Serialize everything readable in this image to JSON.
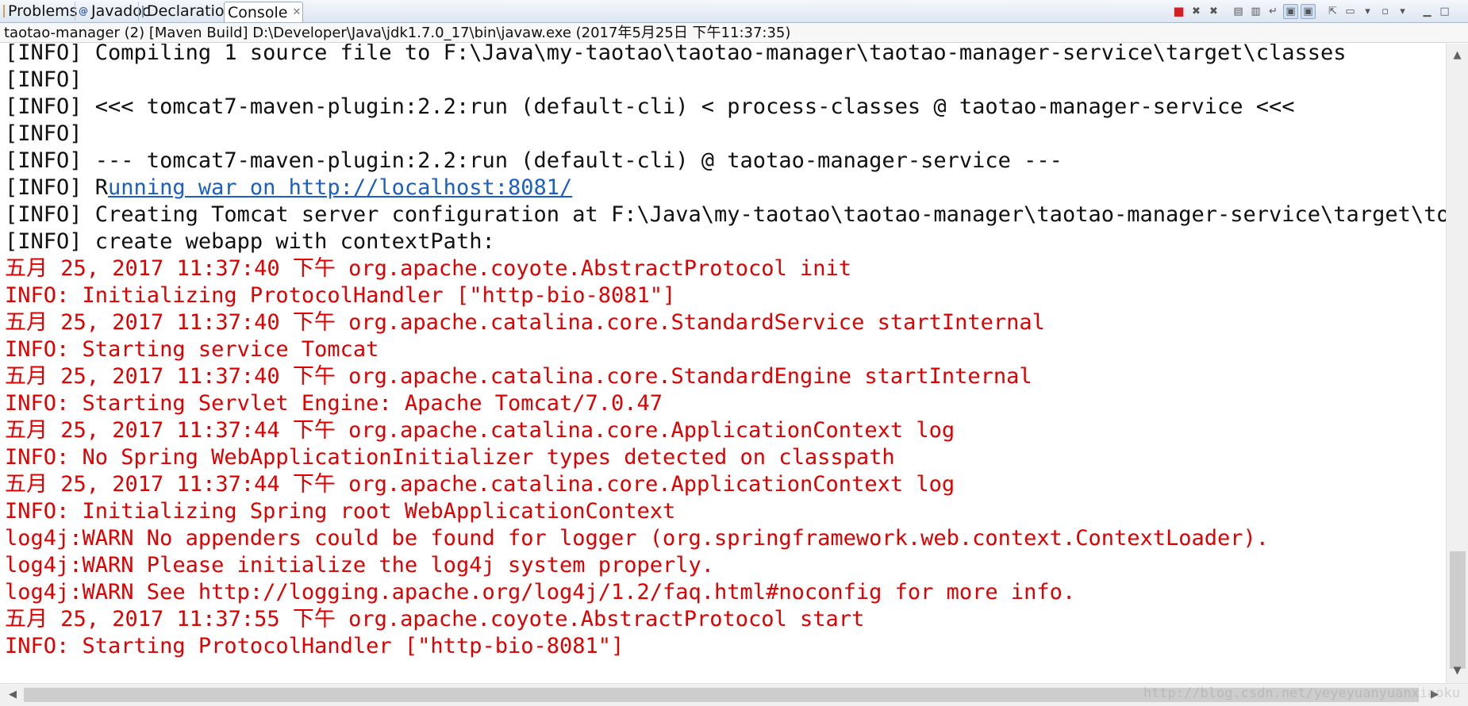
{
  "tabs": [
    {
      "label": "Problems",
      "icon": "problems-icon",
      "active": false
    },
    {
      "label": "Javadoc",
      "icon": "javadoc-icon",
      "active": false
    },
    {
      "label": "Declaration",
      "icon": "declaration-icon",
      "active": false
    },
    {
      "label": "Console",
      "icon": "console-icon",
      "active": true
    }
  ],
  "tab_close_glyph": "✕",
  "process_description": "taotao-manager (2) [Maven Build] D:\\Developer\\Java\\jdk1.7.0_17\\bin\\javaw.exe (2017年5月25日 下午11:37:35)",
  "console": {
    "lines": [
      {
        "text": "[INFO] Compiling 1 source file to F:\\Java\\my-taotao\\taotao-manager\\taotao-manager-service\\target\\classes",
        "color": "black"
      },
      {
        "text": "[INFO]",
        "color": "black"
      },
      {
        "text": "[INFO] <<< tomcat7-maven-plugin:2.2:run (default-cli) < process-classes @ taotao-manager-service <<<",
        "color": "black"
      },
      {
        "text": "[INFO]",
        "color": "black"
      },
      {
        "text": "[INFO] --- tomcat7-maven-plugin:2.2:run (default-cli) @ taotao-manager-service ---",
        "color": "black"
      },
      {
        "text": "[INFO] R",
        "link": "unning war on http://localhost:8081/",
        "color": "black"
      },
      {
        "text": "[INFO] Creating Tomcat server configuration at F:\\Java\\my-taotao\\taotao-manager\\taotao-manager-service\\target\\tomcat",
        "color": "black"
      },
      {
        "text": "[INFO] create webapp with contextPath:",
        "color": "black"
      },
      {
        "text": "五月 25, 2017 11:37:40 下午 org.apache.coyote.AbstractProtocol init",
        "color": "red"
      },
      {
        "text": "INFO: Initializing ProtocolHandler [\"http-bio-8081\"]",
        "color": "red"
      },
      {
        "text": "五月 25, 2017 11:37:40 下午 org.apache.catalina.core.StandardService startInternal",
        "color": "red"
      },
      {
        "text": "INFO: Starting service Tomcat",
        "color": "red"
      },
      {
        "text": "五月 25, 2017 11:37:40 下午 org.apache.catalina.core.StandardEngine startInternal",
        "color": "red"
      },
      {
        "text": "INFO: Starting Servlet Engine: Apache Tomcat/7.0.47",
        "color": "red"
      },
      {
        "text": "五月 25, 2017 11:37:44 下午 org.apache.catalina.core.ApplicationContext log",
        "color": "red"
      },
      {
        "text": "INFO: No Spring WebApplicationInitializer types detected on classpath",
        "color": "red"
      },
      {
        "text": "五月 25, 2017 11:37:44 下午 org.apache.catalina.core.ApplicationContext log",
        "color": "red"
      },
      {
        "text": "INFO: Initializing Spring root WebApplicationContext",
        "color": "red"
      },
      {
        "text": "log4j:WARN No appenders could be found for logger (org.springframework.web.context.ContextLoader).",
        "color": "red"
      },
      {
        "text": "log4j:WARN Please initialize the log4j system properly.",
        "color": "red"
      },
      {
        "text": "log4j:WARN See http://logging.apache.org/log4j/1.2/faq.html#noconfig for more info.",
        "color": "red"
      },
      {
        "text": "五月 25, 2017 11:37:55 下午 org.apache.coyote.AbstractProtocol start",
        "color": "red"
      },
      {
        "text": "INFO: Starting ProtocolHandler [\"http-bio-8081\"]",
        "color": "red"
      }
    ]
  },
  "colors": {
    "stderr": "#e00000",
    "stdout": "#111111",
    "link": "#1a5fc6"
  },
  "watermark": "http://blog.csdn.net/yeyeyuanyuanxiaoku"
}
